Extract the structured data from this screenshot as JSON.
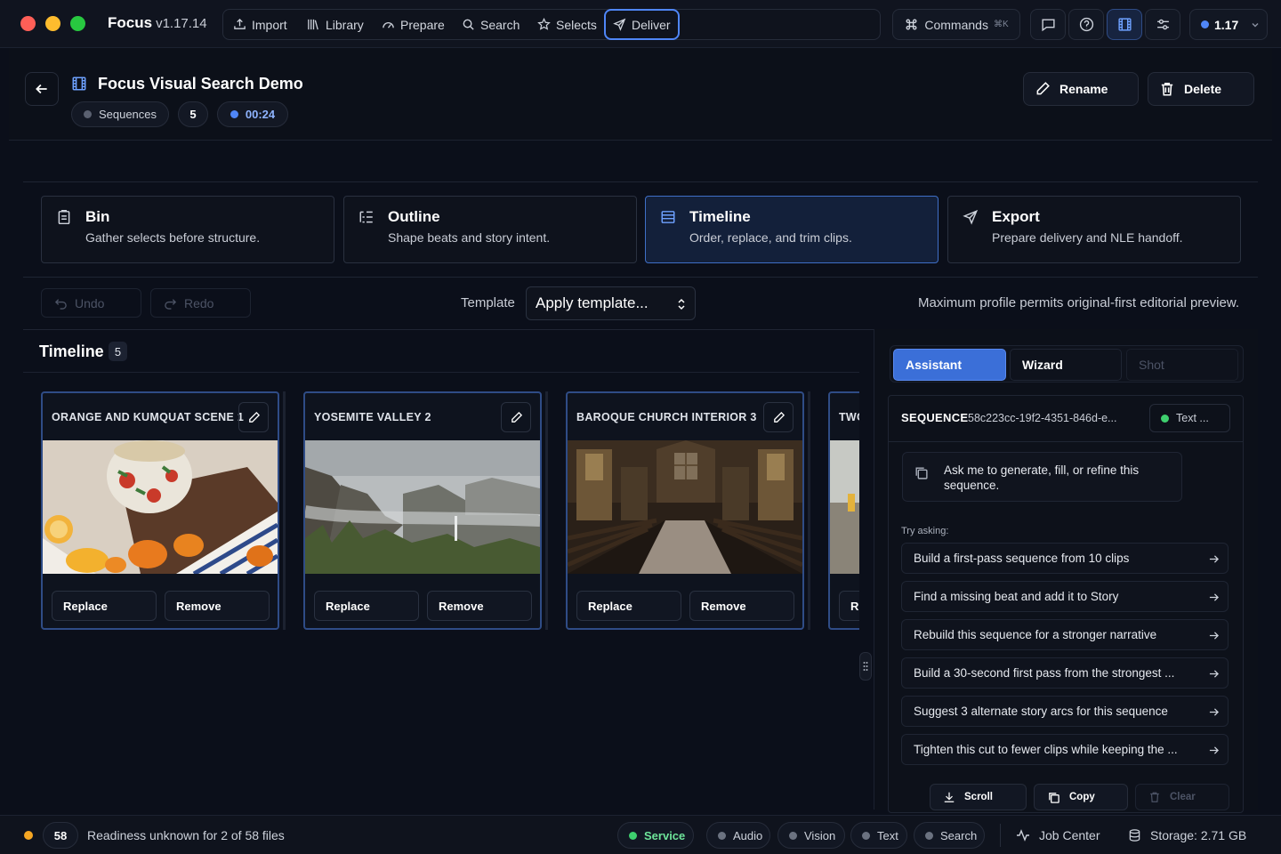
{
  "app": {
    "name": "Focus",
    "version": "v1.17.14"
  },
  "nav": {
    "items": [
      {
        "label": "Import",
        "icon": "upload-icon"
      },
      {
        "label": "Library",
        "icon": "library-icon"
      },
      {
        "label": "Prepare",
        "icon": "gauge-icon"
      },
      {
        "label": "Search",
        "icon": "search-icon"
      },
      {
        "label": "Selects",
        "icon": "star-icon"
      },
      {
        "label": "Deliver",
        "icon": "send-icon",
        "active": true
      }
    ],
    "commands_label": "Commands",
    "commands_shortcut": "⌘K",
    "version_badge": "1.17"
  },
  "header": {
    "title": "Focus Visual Search Demo",
    "pills": {
      "type": "Sequences",
      "count": "5",
      "duration": "00:24"
    },
    "rename_label": "Rename",
    "delete_label": "Delete"
  },
  "stages": [
    {
      "title": "Bin",
      "desc": "Gather selects before structure.",
      "icon": "clipboard-icon"
    },
    {
      "title": "Outline",
      "desc": "Shape beats and story intent.",
      "icon": "outline-icon"
    },
    {
      "title": "Timeline",
      "desc": "Order, replace, and trim clips.",
      "icon": "timeline-icon",
      "active": true
    },
    {
      "title": "Export",
      "desc": "Prepare delivery and NLE handoff.",
      "icon": "send-icon"
    }
  ],
  "toolbar": {
    "undo_label": "Undo",
    "redo_label": "Redo",
    "template_label": "Template",
    "template_value": "Apply template...",
    "profile_note": "Maximum profile permits original-first editorial preview."
  },
  "timeline": {
    "title": "Timeline",
    "count": "5",
    "clips": [
      {
        "title": "ORANGE AND KUMQUAT SCENE 1",
        "replace": "Replace",
        "remove": "Remove"
      },
      {
        "title": "YOSEMITE VALLEY 2",
        "replace": "Replace",
        "remove": "Remove"
      },
      {
        "title": "BAROQUE CHURCH INTERIOR 3",
        "replace": "Replace",
        "remove": "Remove"
      },
      {
        "title": "TWO",
        "replace": "R",
        "remove": ""
      }
    ]
  },
  "assistant": {
    "tabs": [
      "Assistant",
      "Wizard",
      "Shot"
    ],
    "sequence_label": "SEQUENCE",
    "sequence_id": "58c223cc-19f2-4351-846d-e...",
    "text_pill": "Text ...",
    "ask_text": "Ask me to generate, fill, or refine this sequence.",
    "try_label": "Try asking:",
    "suggestions": [
      "Build a first-pass sequence from 10 clips",
      "Find a missing beat and add it to Story",
      "Rebuild this sequence for a stronger narrative",
      "Build a 30-second first pass from the strongest ...",
      "Suggest 3 alternate story arcs for this sequence",
      "Tighten this cut to fewer clips while keeping the ..."
    ],
    "footer": {
      "scroll": "Scroll",
      "copy": "Copy",
      "clear": "Clear"
    }
  },
  "status": {
    "file_count": "58",
    "readiness": "Readiness unknown for 2 of 58 files",
    "services": [
      {
        "label": "Service",
        "color": "#3ecf6e",
        "active": true
      },
      {
        "label": "Audio",
        "color": "#6b7280"
      },
      {
        "label": "Vision",
        "color": "#6b7280"
      },
      {
        "label": "Text",
        "color": "#6b7280"
      },
      {
        "label": "Search",
        "color": "#6b7280"
      }
    ],
    "job_center": "Job Center",
    "storage": "Storage: 2.71 GB"
  },
  "colors": {
    "accent": "#4f86f7",
    "warning": "#f5a623",
    "success": "#3ecf6e"
  }
}
